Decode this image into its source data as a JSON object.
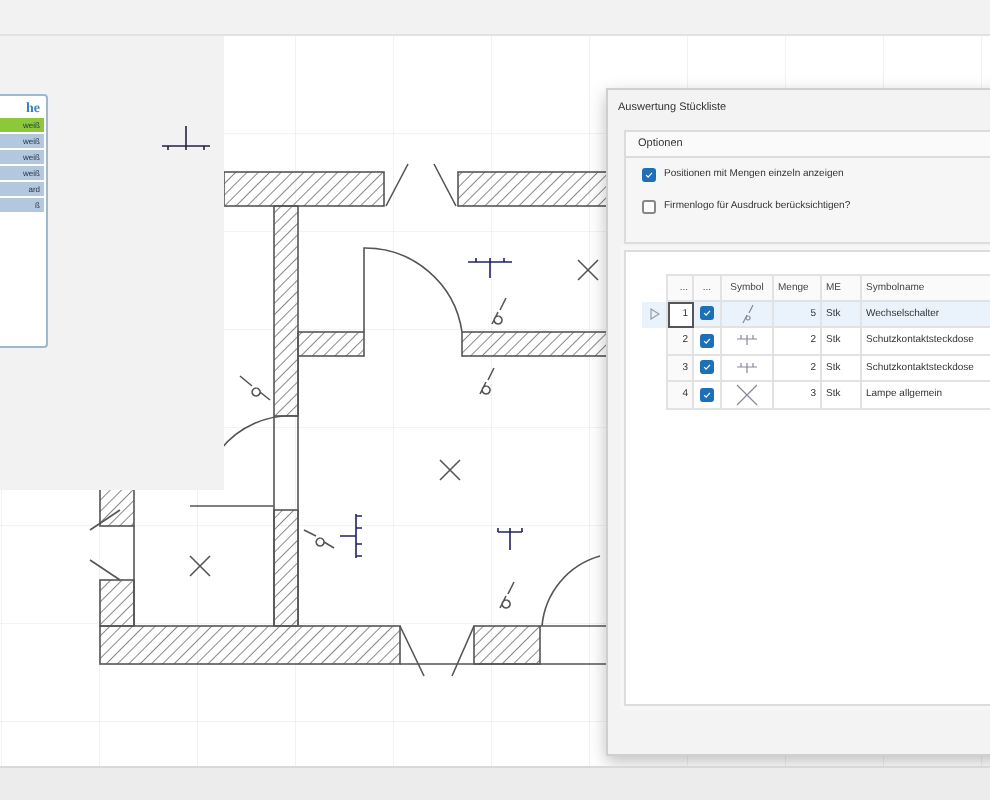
{
  "library_panel": {
    "heading": "he",
    "items": [
      {
        "label": "weiß",
        "selected": true
      },
      {
        "label": "weiß",
        "selected": false
      },
      {
        "label": "weiß",
        "selected": false
      },
      {
        "label": "weiß",
        "selected": false
      },
      {
        "label": "ard",
        "selected": false
      },
      {
        "label": "ß",
        "selected": false
      }
    ]
  },
  "dialog": {
    "title": "Auswertung Stückliste",
    "options": {
      "title": "Optionen",
      "checkboxes": [
        {
          "label": "Positionen mit Mengen einzeln anzeigen",
          "checked": true
        },
        {
          "label": "Firmenlogo für Ausdruck berücksichtigen?",
          "checked": false
        }
      ]
    },
    "table": {
      "columns": [
        "...",
        "...",
        "Symbol",
        "Menge",
        "ME",
        "Symbolname"
      ],
      "rows": [
        {
          "number": "1",
          "checked": true,
          "kind": "switch",
          "quantity": "5",
          "unit": "Stk",
          "name": "Wechselschalter",
          "selected": true
        },
        {
          "number": "2",
          "checked": true,
          "kind": "socket",
          "quantity": "2",
          "unit": "Stk",
          "name": "Schutzkontaktsteckdose",
          "selected": false
        },
        {
          "number": "3",
          "checked": true,
          "kind": "socket",
          "quantity": "2",
          "unit": "Stk",
          "name": "Schutzkontaktsteckdose",
          "selected": false
        },
        {
          "number": "4",
          "checked": true,
          "kind": "lamp",
          "quantity": "3",
          "unit": "Stk",
          "name": "Lampe allgemein",
          "selected": false
        }
      ]
    }
  }
}
